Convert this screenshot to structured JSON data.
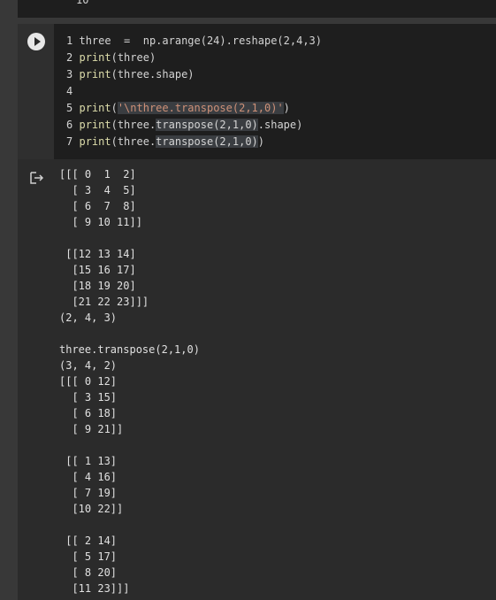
{
  "prev_cell": {
    "output_tail": "10"
  },
  "code_cell": {
    "lines": [
      {
        "num": "1",
        "a": "three  =  np.arange(24).reshape(2,4,3)"
      },
      {
        "num": "2",
        "fn": "print",
        "a": "(three)"
      },
      {
        "num": "3",
        "fn": "print",
        "a": "(three.shape)"
      },
      {
        "num": "4",
        "a": ""
      },
      {
        "num": "5",
        "fn": "print",
        "a": "(",
        "str": "'\\nthree.transpose(2,1,0)'",
        "b": ")"
      },
      {
        "num": "6",
        "fn": "print",
        "a": "(three.",
        "hl": "transpose(2,1,0)",
        "b": ".shape)"
      },
      {
        "num": "7",
        "fn": "print",
        "a": "(three.",
        "hl": "transpose(2,1,0)",
        "b": ")"
      }
    ]
  },
  "output": {
    "text": "[[[ 0  1  2]\n  [ 3  4  5]\n  [ 6  7  8]\n  [ 9 10 11]]\n\n [[12 13 14]\n  [15 16 17]\n  [18 19 20]\n  [21 22 23]]]\n(2, 4, 3)\n\nthree.transpose(2,1,0)\n(3, 4, 2)\n[[[ 0 12]\n  [ 3 15]\n  [ 6 18]\n  [ 9 21]]\n\n [[ 1 13]\n  [ 4 16]\n  [ 7 19]\n  [10 22]]\n\n [[ 2 14]\n  [ 5 17]\n  [ 8 20]\n  [11 23]]]"
  },
  "icons": {
    "run": "play-icon",
    "output": "output-arrow-icon"
  }
}
